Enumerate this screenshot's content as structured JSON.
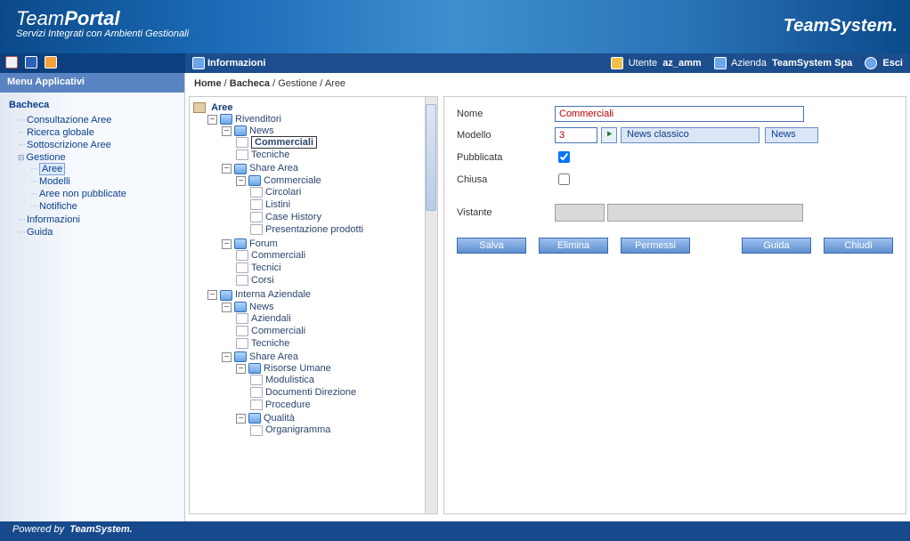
{
  "brand": {
    "team": "Team",
    "portal": "Portal",
    "tagline": "Servizi Integrati con Ambienti Gestionali",
    "right_brand": "TeamSystem.",
    "footer_powered": "Powered by",
    "footer_brand": "TeamSystem."
  },
  "infobar": {
    "title": "Informazioni",
    "user_label": "Utente",
    "user_value": "az_amm",
    "company_label": "Azienda",
    "company_value": "TeamSystem Spa",
    "exit": "Esci"
  },
  "sidebar": {
    "title": "Menu Applicativi",
    "root": "Bacheca",
    "items": {
      "consultazione": "Consultazione Aree",
      "ricerca": "Ricerca globale",
      "sottoscrizione": "Sottoscrizione Aree",
      "gestione": "Gestione",
      "aree": "Aree",
      "modelli": "Modelli",
      "nonpub": "Aree non pubblicate",
      "notifiche": "Notifiche",
      "informazioni": "Informazioni",
      "guida": "Guida"
    }
  },
  "breadcrumb": {
    "p0": "Home",
    "p1": "Bacheca",
    "p2": "Gestione",
    "p3": "Aree"
  },
  "tree": {
    "root": "Aree",
    "rivenditori": "Rivenditori",
    "news1": "News",
    "commerciali_sel": "Commerciali",
    "tecniche1": "Tecniche",
    "sharearea1": "Share Area",
    "commerciale": "Commerciale",
    "circolari": "Circolari",
    "listini": "Listini",
    "casehistory": "Case History",
    "presentazione": "Presentazione prodotti",
    "forum": "Forum",
    "f_comm": "Commerciali",
    "f_tec": "Tecnici",
    "f_corsi": "Corsi",
    "interna": "Interna Aziendale",
    "news2": "News",
    "aziendali": "Aziendali",
    "commerciali2": "Commerciali",
    "tecniche2": "Tecniche",
    "sharearea2": "Share Area",
    "risorse": "Risorse Umane",
    "modulistica": "Modulistica",
    "docdir": "Documenti Direzione",
    "procedure": "Procedure",
    "qualita": "Qualità",
    "organigramma": "Organigramma"
  },
  "form": {
    "labels": {
      "nome": "Nome",
      "modello": "Modello",
      "pubblicata": "Pubblicata",
      "chiusa": "Chiusa",
      "vistante": "Vistante"
    },
    "values": {
      "nome": "Commerciali",
      "modello": "3",
      "modello_desc": "News classico",
      "modello_cat": "News",
      "pubblicata": true,
      "chiusa": false
    },
    "buttons": {
      "salva": "Salva",
      "elimina": "Elimina",
      "permessi": "Permessi",
      "guida": "Guida",
      "chiudi": "Chiudi"
    }
  }
}
